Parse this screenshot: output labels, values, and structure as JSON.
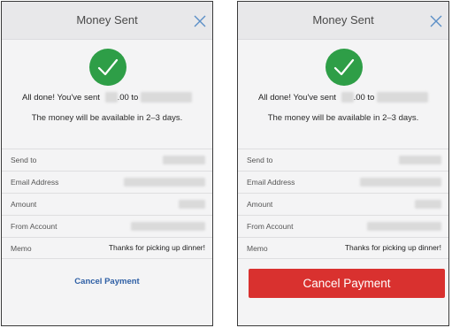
{
  "panels": [
    {
      "title": "Money Sent",
      "done_prefix": "All done! You've sent",
      "done_amount_suffix": ".00",
      "done_to": "to",
      "availability": "The money will be available in 2–3 days.",
      "rows": [
        {
          "label": "Send to"
        },
        {
          "label": "Email Address"
        },
        {
          "label": "Amount"
        },
        {
          "label": "From Account"
        },
        {
          "label": "Memo",
          "value": "Thanks for picking up dinner!"
        }
      ],
      "cancel_label": "Cancel Payment",
      "cancel_style": "link"
    },
    {
      "title": "Money Sent",
      "done_prefix": "All done! You've sent",
      "done_amount_suffix": ".00",
      "done_to": "to",
      "availability": "The money will be available in 2–3 days.",
      "rows": [
        {
          "label": "Send to"
        },
        {
          "label": "Email Address"
        },
        {
          "label": "Amount"
        },
        {
          "label": "From Account"
        },
        {
          "label": "Memo",
          "value": "Thanks for picking up dinner!"
        }
      ],
      "cancel_label": "Cancel Payment",
      "cancel_style": "button"
    }
  ],
  "icons": {
    "close": "close-icon",
    "success": "checkmark-circle-icon"
  },
  "colors": {
    "success_green": "#2e9e47",
    "link_blue": "#2e5fa5",
    "cancel_red": "#d9312f",
    "close_blue": "#5b8fc7"
  }
}
